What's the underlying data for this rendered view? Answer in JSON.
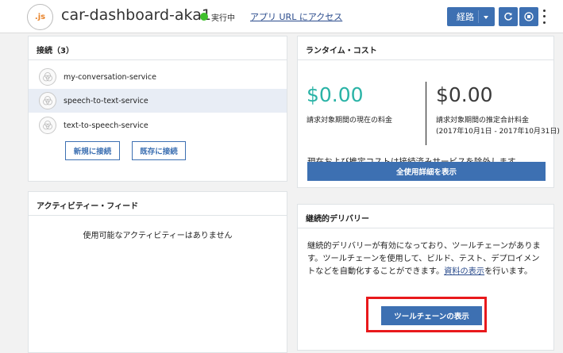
{
  "header": {
    "app_icon_label": ".js",
    "app_name": "car-dashboard-aka1",
    "status": "実行中",
    "app_url_link": "アプリ URL にアクセス",
    "route_button": "経路"
  },
  "connections": {
    "title": "接続（3）",
    "items": [
      {
        "label": "my-conversation-service"
      },
      {
        "label": "speech-to-text-service"
      },
      {
        "label": "text-to-speech-service"
      }
    ],
    "new_button": "新規に接続",
    "existing_button": "既存に接続"
  },
  "activity": {
    "title": "アクティビティー・フィード",
    "empty": "使用可能なアクティビティーはありません"
  },
  "cost": {
    "title": "ランタイム・コスト",
    "current_value": "$0.00",
    "current_label": "請求対象期間の現在の料金",
    "estimated_value": "$0.00",
    "estimated_label": "請求対象期間の推定合計料金",
    "period": "(2017年10月1日 - 2017年10月31日)",
    "note_prefix": "現在および推定コストは",
    "note_link": "接続済みサービス",
    "note_suffix": "を除外します。",
    "details_button": "全使用詳細を表示"
  },
  "delivery": {
    "title": "継続的デリバリー",
    "text": "継続的デリバリーが有効になっており、ツールチェーンがあります。ツールチェーンを使用して、ビルド、テスト、デプロイメントなどを自動化することができます。",
    "link": "資料の表示",
    "text_suffix": "を行います。",
    "toolchain_button": "ツールチェーンの表示"
  },
  "colors": {
    "accent": "#3d70b2",
    "current_cost": "#2ab3a6",
    "highlight": "#e8191c",
    "status": "#3fbf2c"
  }
}
